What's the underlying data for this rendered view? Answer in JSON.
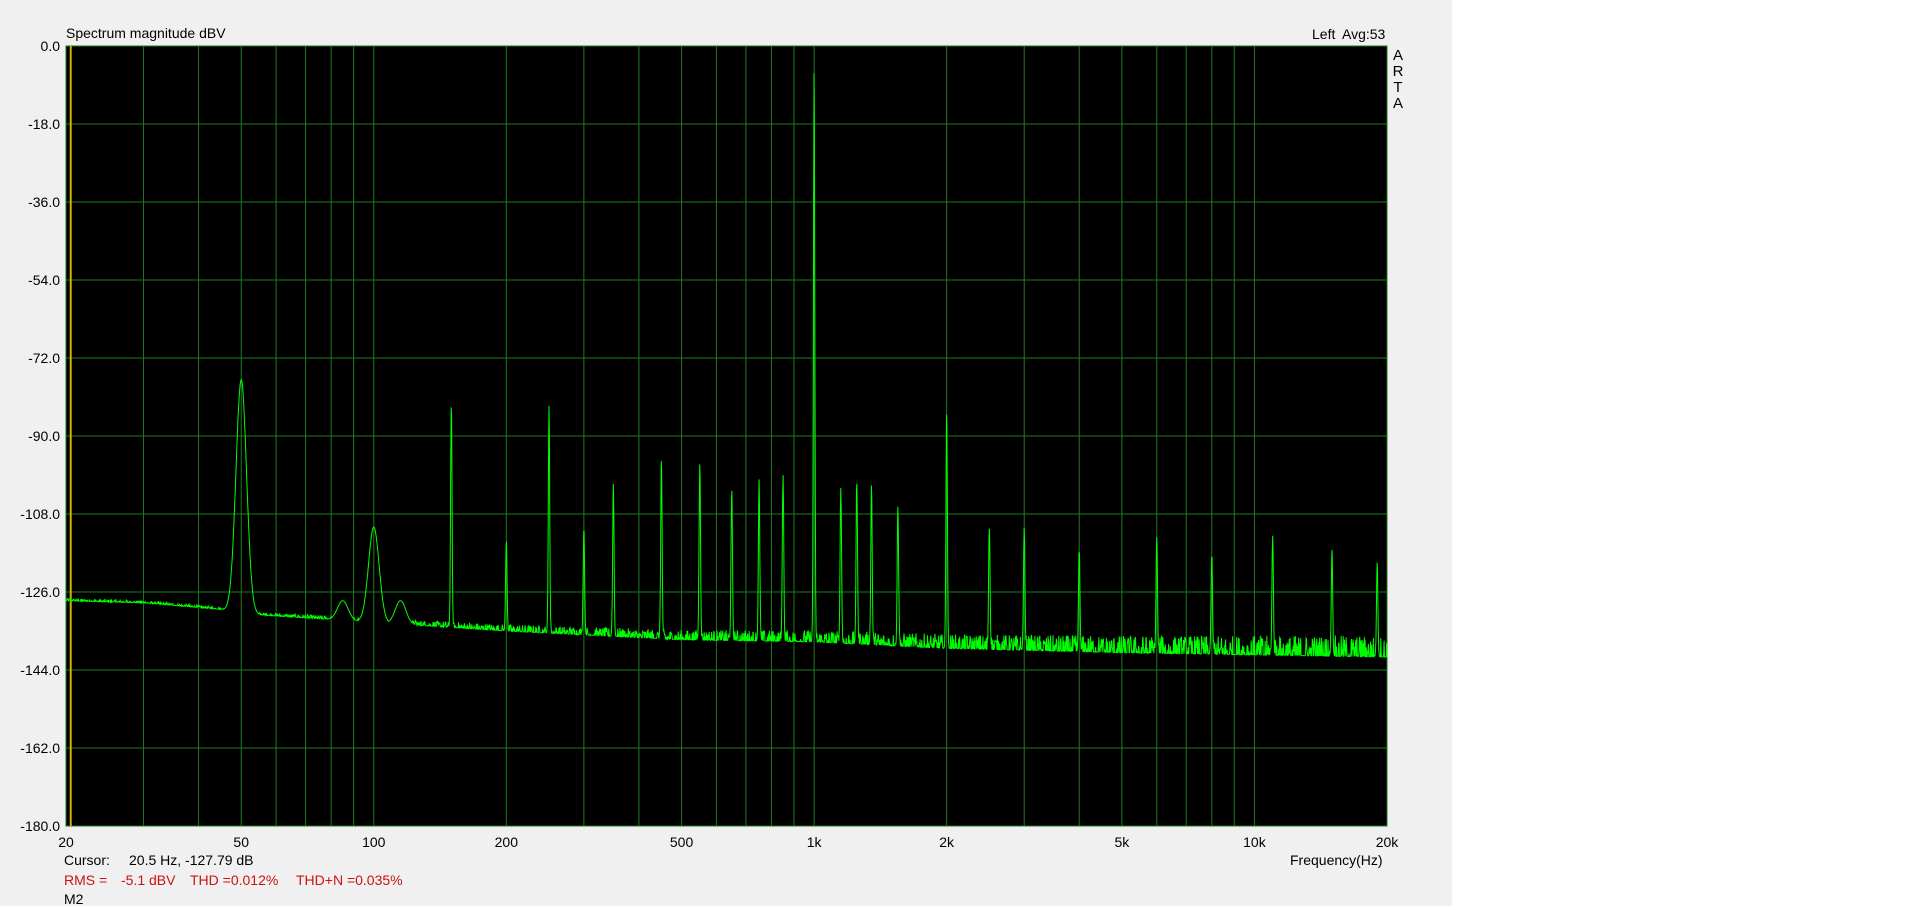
{
  "header": {
    "title": "Spectrum magnitude dBV",
    "channel": "Left",
    "avg": "Avg:53"
  },
  "brand": [
    "A",
    "R",
    "T",
    "A"
  ],
  "footer": {
    "cursor_label": "Cursor:",
    "cursor_value": "20.5 Hz, -127.79 dB",
    "rms_label": "RMS =",
    "rms_value": "-5.1 dBV",
    "thd": "THD =0.012%",
    "thdn": "THD+N =0.035%",
    "marker": "M2"
  },
  "colors": {
    "plot_bg": "#000000",
    "grid": "#1f7a1f",
    "trace": "#00ff00",
    "cursor_line": "#d4b000",
    "stats_text": "#cc1111"
  },
  "chart_data": {
    "type": "line",
    "title": "Spectrum magnitude dBV",
    "xlabel": "Frequency(Hz)",
    "ylabel": "",
    "xscale": "log",
    "xlim": [
      20,
      20000
    ],
    "ylim": [
      -180,
      0
    ],
    "y_ticks": [
      "0.0",
      "-18.0",
      "-36.0",
      "-54.0",
      "-72.0",
      "-90.0",
      "-108.0",
      "-126.0",
      "-144.0",
      "-162.0",
      "-180.0"
    ],
    "x_ticks": [
      {
        "v": 20,
        "label": "20"
      },
      {
        "v": 50,
        "label": "50"
      },
      {
        "v": 100,
        "label": "100"
      },
      {
        "v": 200,
        "label": "200"
      },
      {
        "v": 500,
        "label": "500"
      },
      {
        "v": 1000,
        "label": "1k"
      },
      {
        "v": 2000,
        "label": "2k"
      },
      {
        "v": 5000,
        "label": "5k"
      },
      {
        "v": 10000,
        "label": "10k"
      },
      {
        "v": 20000,
        "label": "20k"
      }
    ],
    "grid": true,
    "cursor_frequency": 20.5,
    "noise_floor": [
      [
        20,
        -128
      ],
      [
        30,
        -128.5
      ],
      [
        45,
        -130
      ],
      [
        50,
        -131
      ],
      [
        100,
        -133
      ],
      [
        200,
        -135
      ],
      [
        500,
        -137
      ],
      [
        1000,
        -137.5
      ],
      [
        2000,
        -139
      ],
      [
        5000,
        -140
      ],
      [
        10000,
        -140.5
      ],
      [
        20000,
        -141
      ]
    ],
    "peaks": [
      {
        "f": 50,
        "db": -77
      },
      {
        "f": 85,
        "db": -128
      },
      {
        "f": 100,
        "db": -111
      },
      {
        "f": 115,
        "db": -128
      },
      {
        "f": 150,
        "db": -82
      },
      {
        "f": 200,
        "db": -114
      },
      {
        "f": 250,
        "db": -83
      },
      {
        "f": 300,
        "db": -111
      },
      {
        "f": 350,
        "db": -101
      },
      {
        "f": 450,
        "db": -95
      },
      {
        "f": 550,
        "db": -96
      },
      {
        "f": 650,
        "db": -102
      },
      {
        "f": 750,
        "db": -100
      },
      {
        "f": 850,
        "db": -99
      },
      {
        "f": 1000,
        "db": -5
      },
      {
        "f": 1150,
        "db": -102
      },
      {
        "f": 1250,
        "db": -100
      },
      {
        "f": 1350,
        "db": -101
      },
      {
        "f": 1550,
        "db": -106
      },
      {
        "f": 2000,
        "db": -84
      },
      {
        "f": 2500,
        "db": -111
      },
      {
        "f": 3000,
        "db": -111
      },
      {
        "f": 4000,
        "db": -116
      },
      {
        "f": 6000,
        "db": -113
      },
      {
        "f": 8000,
        "db": -117
      },
      {
        "f": 11000,
        "db": -113
      },
      {
        "f": 15000,
        "db": -116
      },
      {
        "f": 19000,
        "db": -119
      }
    ]
  }
}
